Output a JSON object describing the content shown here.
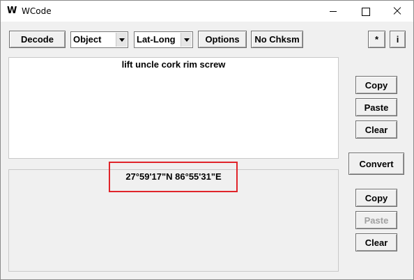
{
  "window": {
    "title": "WCode",
    "app_icon": "W"
  },
  "toolbar": {
    "decode_label": "Decode",
    "object_value": "Object",
    "format_value": "Lat-Long",
    "options_label": "Options",
    "checksum_label": "No Chksm",
    "star_label": "*",
    "info_label": "i"
  },
  "input": {
    "text": "lift uncle cork rim screw"
  },
  "output": {
    "text": "27°59'17\"N 86°55'31\"E"
  },
  "side_top": {
    "copy_label": "Copy",
    "paste_label": "Paste",
    "clear_label": "Clear"
  },
  "convert_label": "Convert",
  "side_bottom": {
    "copy_label": "Copy",
    "paste_label": "Paste",
    "clear_label": "Clear"
  },
  "colors": {
    "highlight": "#e0242a",
    "window_bg": "#f0f0f0",
    "disabled_text": "#a0a0a0"
  }
}
